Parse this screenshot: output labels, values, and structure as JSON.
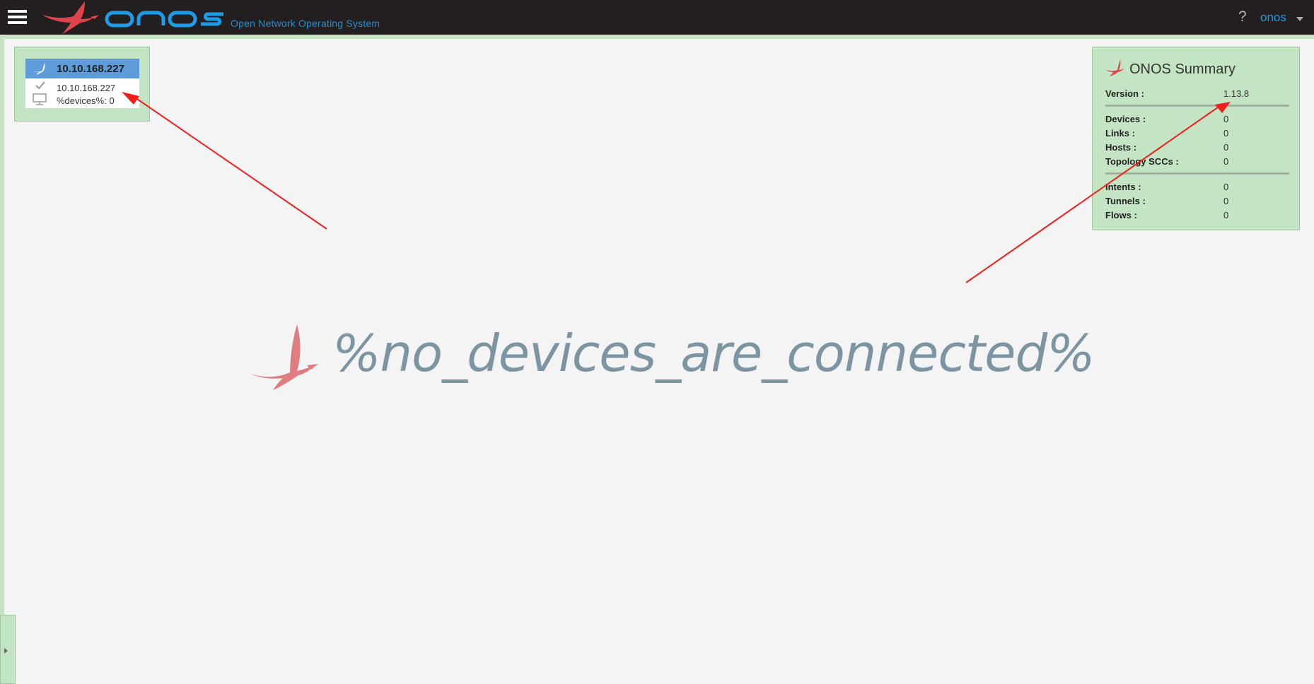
{
  "header": {
    "logo_subtitle": "Open Network Operating System",
    "help_label": "?",
    "user_label": "onos"
  },
  "instance": {
    "title": "10.10.168.227",
    "ip": "10.10.168.227",
    "devices_label": "%devices%:",
    "devices_value": "0"
  },
  "summary": {
    "title": "ONOS Summary",
    "rows": [
      {
        "label": "Version :",
        "value": "1.13.8"
      },
      {
        "label": "Devices :",
        "value": "0"
      },
      {
        "label": "Links :",
        "value": "0"
      },
      {
        "label": "Hosts :",
        "value": "0"
      },
      {
        "label": "Topology SCCs :",
        "value": "0"
      },
      {
        "label": "Intents :",
        "value": "0"
      },
      {
        "label": "Tunnels :",
        "value": "0"
      },
      {
        "label": "Flows :",
        "value": "0"
      }
    ]
  },
  "main": {
    "message": "%no_devices_are_connected%"
  },
  "colors": {
    "topbar": "#231f20",
    "panel_green": "#c4e5c3",
    "instance_header_blue": "#5e9cd9",
    "brand_red": "#e0444a",
    "brand_blue": "#1f9ce6",
    "message_gray": "#7c95a3",
    "annotation_red": "#f21d1d"
  },
  "icons": {
    "menu": "hamburger-icon",
    "logo": "onos-bird-icon",
    "help": "question-mark-icon",
    "user_menu": "caret-down-icon",
    "instance_ready": "check-icon",
    "instance_devices": "monitor-icon",
    "side_toggle": "chevron-right-icon"
  }
}
